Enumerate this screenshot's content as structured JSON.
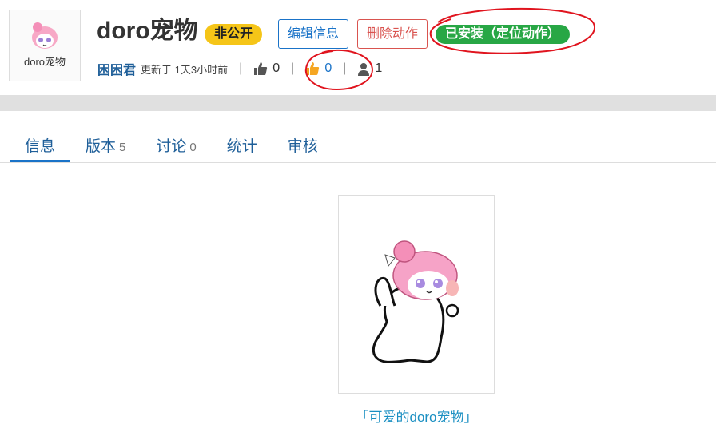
{
  "header": {
    "thumbnail_label": "doro宠物",
    "title": "doro宠物",
    "visibility_badge": "非公开",
    "edit_button": "编辑信息",
    "delete_button": "删除动作",
    "installed_badge": "已安装（定位动作）"
  },
  "meta": {
    "author": "困困君",
    "updated": "更新于 1天3小时前",
    "separator": "|",
    "likes": "0",
    "thumbs_up": "0",
    "users": "1"
  },
  "tabs": [
    {
      "label": "信息",
      "count": ""
    },
    {
      "label": "版本",
      "count": "5"
    },
    {
      "label": "讨论",
      "count": "0"
    },
    {
      "label": "统计",
      "count": ""
    },
    {
      "label": "审核",
      "count": ""
    }
  ],
  "preview": {
    "caption": "「可爱的doro宠物」"
  },
  "colors": {
    "link": "#1f5f99",
    "accent_blue": "#1a73c8",
    "private_badge": "#f5c518",
    "installed_badge": "#28a745",
    "delete_red": "#d9534f",
    "annotation_red": "#e0141e",
    "caption": "#1a8fc2"
  },
  "icons": [
    "thumbs-up-dark-icon",
    "thumbs-up-orange-icon",
    "user-icon"
  ]
}
